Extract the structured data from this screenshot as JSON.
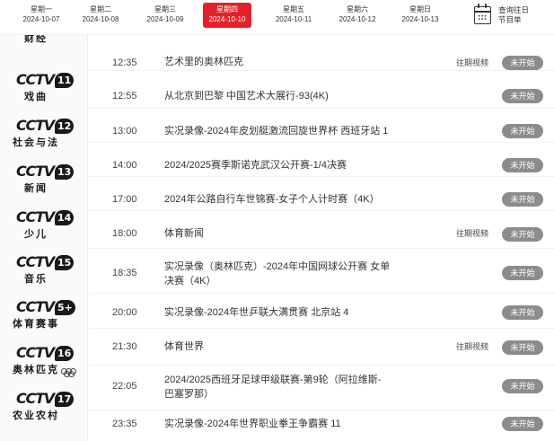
{
  "date_bar": {
    "days": [
      {
        "weekday": "星期一",
        "date": "2024-10-07",
        "active": false
      },
      {
        "weekday": "星期二",
        "date": "2024-10-08",
        "active": false
      },
      {
        "weekday": "星期三",
        "date": "2024-10-09",
        "active": false
      },
      {
        "weekday": "星期四",
        "date": "2024-10-10",
        "active": true
      },
      {
        "weekday": "星期五",
        "date": "2024-10-11",
        "active": false
      },
      {
        "weekday": "星期六",
        "date": "2024-10-12",
        "active": false
      },
      {
        "weekday": "星期日",
        "date": "2024-10-13",
        "active": false
      }
    ],
    "calendar_line1": "查询往日",
    "calendar_line2": "节目单",
    "active_color": "#e5202a"
  },
  "channels": [
    {
      "logo": "",
      "number": "",
      "name": "财经",
      "partial": true
    },
    {
      "logo": "CCTV",
      "number": "11",
      "name": "戏曲"
    },
    {
      "logo": "CCTV",
      "number": "12",
      "name": "社会与法"
    },
    {
      "logo": "CCTV",
      "number": "13",
      "name": "新闻"
    },
    {
      "logo": "CCTV",
      "number": "14",
      "name": "少儿"
    },
    {
      "logo": "CCTV",
      "number": "15",
      "name": "音乐"
    },
    {
      "logo": "CCTV",
      "number": "5+",
      "name": "体育赛事"
    },
    {
      "logo": "CCTV",
      "number": "16",
      "name": "奥林匹克",
      "olympic_rings": true
    },
    {
      "logo": "CCTV",
      "number": "17",
      "name": "农业农村"
    }
  ],
  "programs": [
    {
      "time": "12:35",
      "title": "艺术里的奥林匹克",
      "replay": "往期视频",
      "status": "未开始"
    },
    {
      "time": "12:55",
      "title": "从北京到巴黎 中国艺术大展行-93(4K)",
      "replay": "",
      "status": "未开始"
    },
    {
      "time": "13:00",
      "title": "实况录像-2024年皮划艇激流回旋世界杯 西班牙站 1",
      "replay": "",
      "status": "未开始"
    },
    {
      "time": "14:00",
      "title": "2024/2025赛季斯诺克武汉公开赛-1/4决赛",
      "replay": "",
      "status": "未开始"
    },
    {
      "time": "17:00",
      "title": "2024年公路自行车世锦赛-女子个人计时赛（4K）",
      "replay": "",
      "status": "未开始"
    },
    {
      "time": "18:00",
      "title": "体育新闻",
      "replay": "往期视频",
      "status": "未开始"
    },
    {
      "time": "18:35",
      "title": "实况录像（奥林匹克）-2024年中国网球公开赛 女单决赛（4K）",
      "replay": "",
      "status": "未开始"
    },
    {
      "time": "20:00",
      "title": "实况录像-2024年世乒联大满贯赛 北京站 4",
      "replay": "",
      "status": "未开始"
    },
    {
      "time": "21:30",
      "title": "体育世界",
      "replay": "往期视频",
      "status": "未开始"
    },
    {
      "time": "22:05",
      "title": "2024/2025西班牙足球甲级联赛-第9轮（阿拉维斯-巴塞罗那）",
      "replay": "",
      "status": "未开始"
    },
    {
      "time": "23:35",
      "title": "实况录像-2024年世界职业拳王争霸赛 11",
      "replay": "",
      "status": "未开始"
    }
  ]
}
